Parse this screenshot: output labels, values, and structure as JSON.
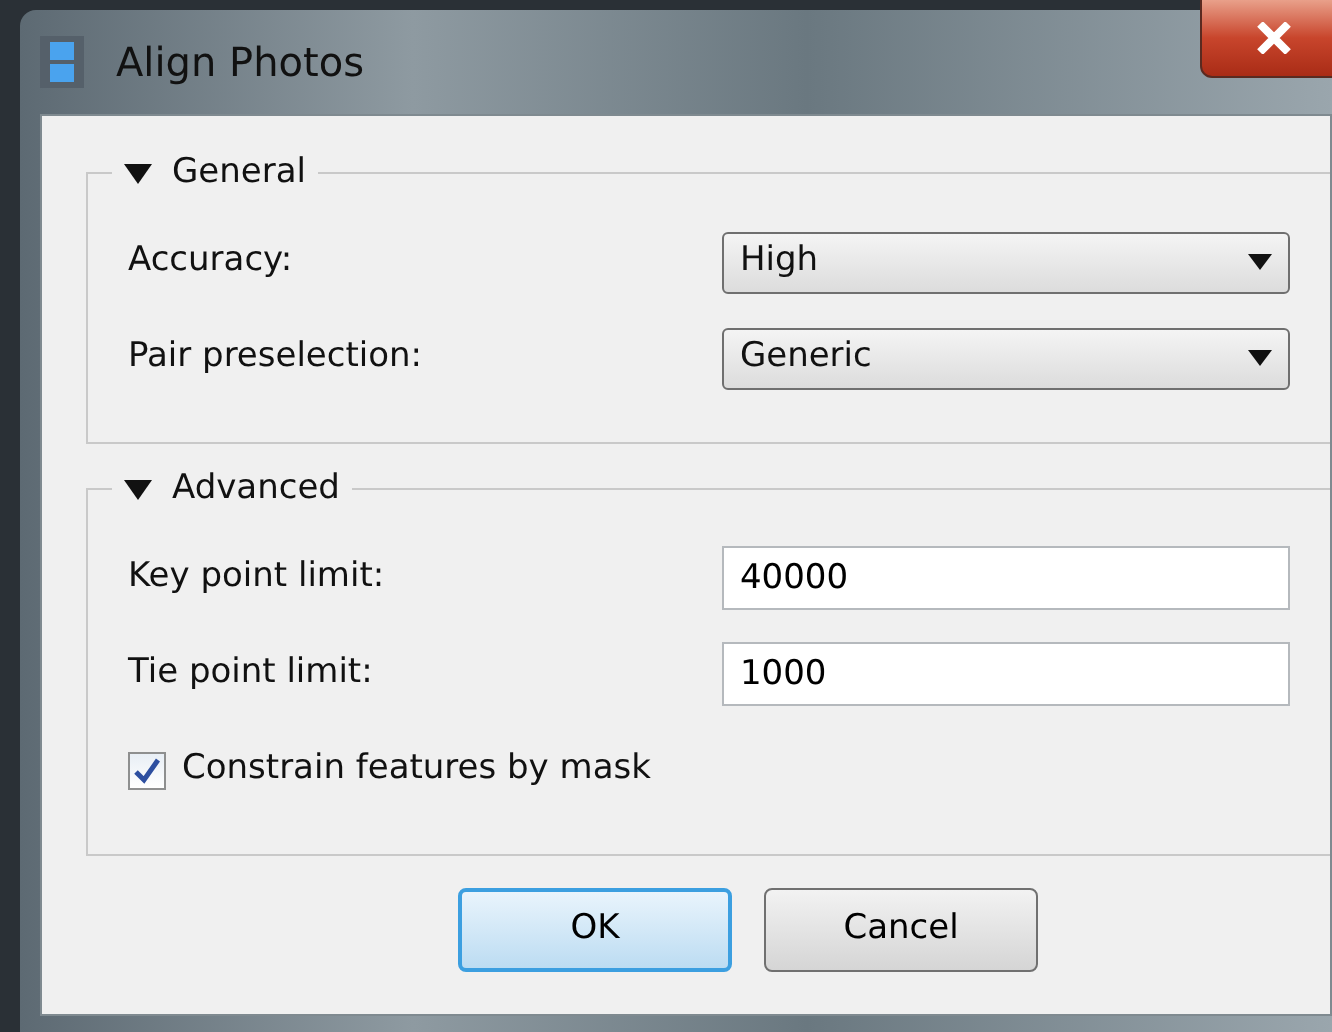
{
  "window": {
    "title": "Align Photos"
  },
  "groups": [
    {
      "title": "General",
      "expanded": true,
      "rows": [
        {
          "kind": "dropdown",
          "label": "Accuracy:",
          "value": "High"
        },
        {
          "kind": "dropdown",
          "label": "Pair preselection:",
          "value": "Generic"
        }
      ]
    },
    {
      "title": "Advanced",
      "expanded": true,
      "rows": [
        {
          "kind": "input",
          "label": "Key point limit:",
          "value": "40000"
        },
        {
          "kind": "input",
          "label": "Tie point limit:",
          "value": "1000"
        },
        {
          "kind": "checkbox",
          "label": "Constrain features by mask",
          "checked": true
        }
      ]
    }
  ],
  "buttons": [
    {
      "label": "OK",
      "default": true
    },
    {
      "label": "Cancel",
      "default": false
    }
  ]
}
